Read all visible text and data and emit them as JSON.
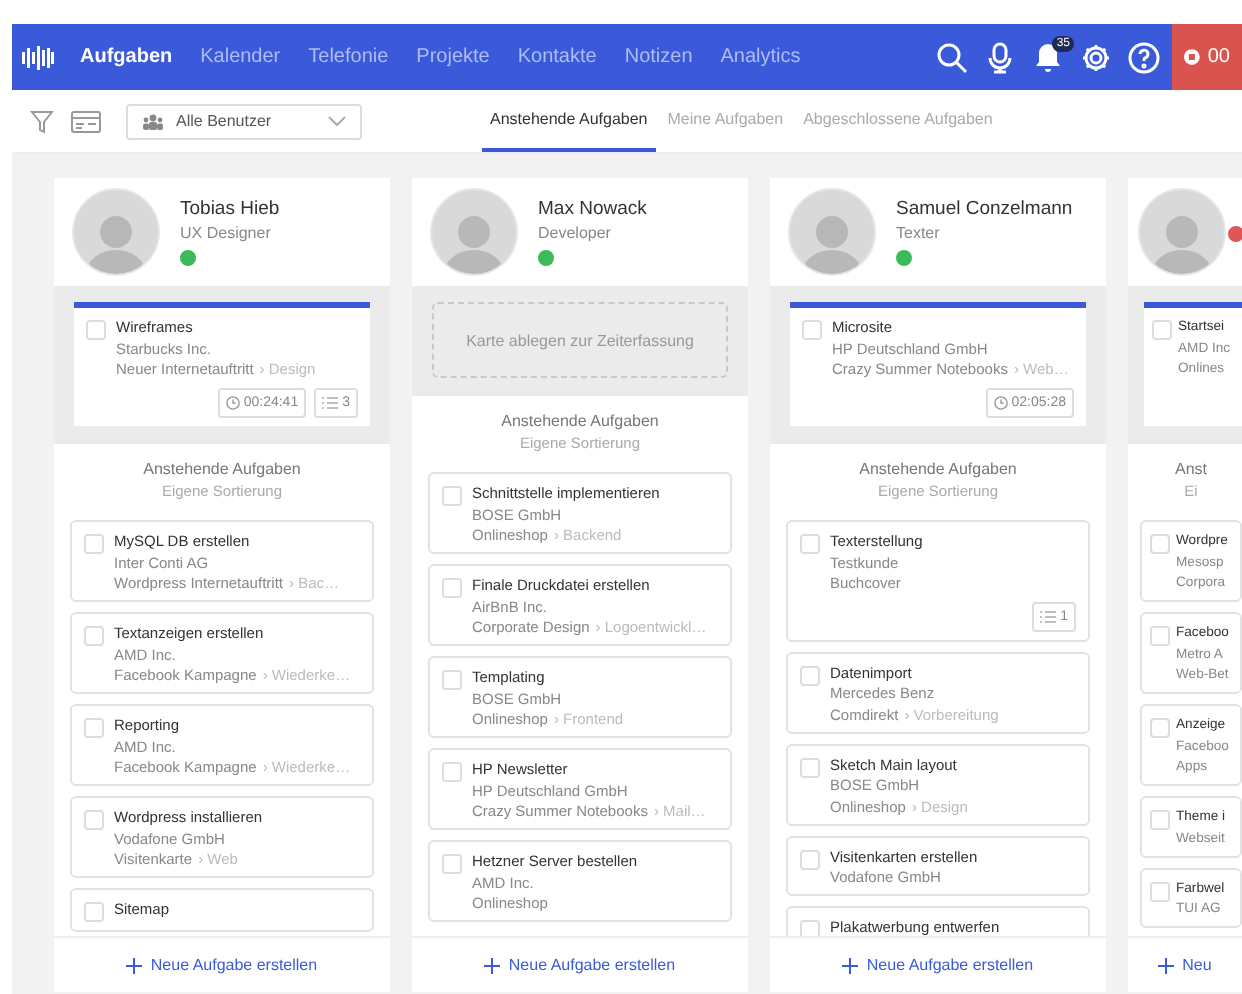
{
  "nav": {
    "items": [
      {
        "label": "Aufgaben",
        "selected": true
      },
      {
        "label": "Kalender",
        "selected": false
      },
      {
        "label": "Telefonie",
        "selected": false
      },
      {
        "label": "Projekte",
        "selected": false
      },
      {
        "label": "Kontakte",
        "selected": false
      },
      {
        "label": "Notizen",
        "selected": false
      },
      {
        "label": "Analytics",
        "selected": false
      }
    ],
    "notifications": "35",
    "timer": "00"
  },
  "toolbar": {
    "user_filter": "Alle Benutzer",
    "tabs": [
      {
        "label": "Anstehende Aufgaben",
        "selected": true
      },
      {
        "label": "Meine Aufgaben",
        "selected": false
      },
      {
        "label": "Abgeschlossene Aufgaben",
        "selected": false
      }
    ]
  },
  "columns": [
    {
      "name": "Tobias Hieb",
      "role": "UX Designer",
      "color": "#3dbb5c",
      "active": {
        "kind": "task",
        "title": "Wireframes",
        "client": "Starbucks Inc.",
        "project": "Neuer Internetauftritt",
        "phase": "› Design",
        "timer": "00:24:41",
        "subtasks": "3",
        "checked": false
      },
      "list_title": "Anstehende Aufgaben",
      "list_subtitle": "Eigene Sortierung",
      "tasks": [
        {
          "title": "MySQL DB erstellen",
          "client": "Inter Conti AG",
          "project": "Wordpress Internetauftritt",
          "phase": "› Bac…",
          "checked": false
        },
        {
          "title": "Textanzeigen erstellen",
          "client": "AMD Inc.",
          "project": "Facebook Kampagne",
          "phase": "› Wiederke…",
          "checked": false
        },
        {
          "title": "Reporting",
          "client": "AMD Inc.",
          "project": "Facebook Kampagne",
          "phase": "› Wiederke…",
          "checked": false
        },
        {
          "title": "Wordpress installieren",
          "client": "Vodafone GmbH",
          "project": "Visitenkarte",
          "phase": "› Web",
          "checked": false
        },
        {
          "title": "Sitemap",
          "checked": false
        }
      ],
      "add_label": "Neue Aufgabe erstellen"
    },
    {
      "name": "Max Nowack",
      "role": "Developer",
      "color": "#3dbb5c",
      "active": {
        "kind": "dropzone",
        "label": "Karte ablegen zur Zeiterfassung"
      },
      "list_title": "Anstehende Aufgaben",
      "list_subtitle": "Eigene Sortierung",
      "tasks": [
        {
          "title": "Schnittstelle implementieren",
          "client": "BOSE GmbH",
          "project": "Onlineshop",
          "phase": "› Backend",
          "checked": false
        },
        {
          "title": "Finale Druckdatei erstellen",
          "client": "AirBnB Inc.",
          "project": "Corporate Design",
          "phase": "› Logoentwickl…",
          "checked": false
        },
        {
          "title": "Templating",
          "client": "BOSE GmbH",
          "project": "Onlineshop",
          "phase": "› Frontend",
          "checked": false
        },
        {
          "title": "HP Newsletter",
          "client": "HP Deutschland GmbH",
          "project": "Crazy Summer Notebooks",
          "phase": "› Mail…",
          "checked": false
        },
        {
          "title": "Hetzner Server bestellen",
          "client": "AMD Inc.",
          "project": "Onlineshop",
          "checked": false
        }
      ],
      "add_label": "Neue Aufgabe erstellen"
    },
    {
      "name": "Samuel Conzelmann",
      "role": "Texter",
      "color": "#3dbb5c",
      "active": {
        "kind": "task",
        "title": "Microsite",
        "client": "HP Deutschland GmbH",
        "project": "Crazy Summer Notebooks",
        "phase": "› Web…",
        "timer": "02:05:28",
        "checked": false
      },
      "list_title": "Anstehende Aufgaben",
      "list_subtitle": "Eigene Sortierung",
      "tasks": [
        {
          "title": "Texterstellung",
          "client": "Testkunde",
          "project": "Buchcover",
          "subtasks": "1",
          "checked": false
        },
        {
          "title": "Datenimport",
          "client": "Mercedes Benz",
          "project": "Comdirekt",
          "phase": "› Vorbereitung",
          "checked": false
        },
        {
          "title": "Sketch Main layout",
          "client": "BOSE GmbH",
          "project": "Onlineshop",
          "phase": "› Design",
          "checked": false
        },
        {
          "title": "Visitenkarten erstellen",
          "client": "Vodafone GmbH",
          "checked": false
        },
        {
          "title": "Plakatwerbung entwerfen",
          "checked": false
        }
      ],
      "add_label": "Neue Aufgabe erstellen"
    },
    {
      "color": "#e05555",
      "active": {
        "kind": "task",
        "title": "Startsei",
        "client": "AMD Inc",
        "project": "Onlines",
        "checked": false
      },
      "list_title": "Anst",
      "list_subtitle": "Ei",
      "tasks": [
        {
          "title": "Wordpre",
          "client": "Mesosp",
          "project": "Corpora",
          "checked": false
        },
        {
          "title": "Faceboo",
          "client": "Metro A",
          "project": "Web-Bet",
          "checked": false
        },
        {
          "title": "Anzeige",
          "client": "Faceboo",
          "project": "Apps",
          "checked": false
        },
        {
          "title": "Theme i",
          "client": "Webseit",
          "checked": false
        },
        {
          "title": "Farbwel",
          "client": "TUI AG",
          "checked": false
        }
      ],
      "add_label": "Neu"
    }
  ]
}
